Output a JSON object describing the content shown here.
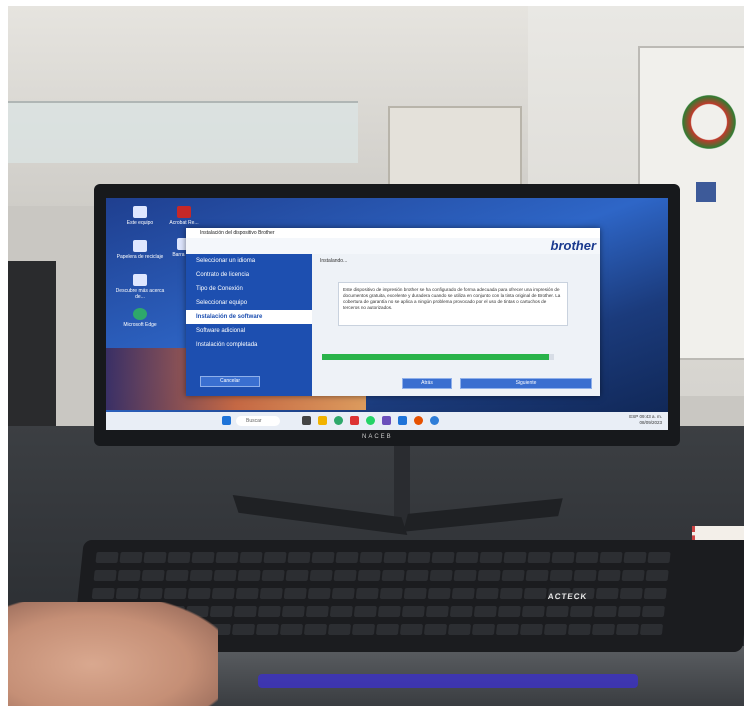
{
  "desktop_icons": [
    {
      "label": "Este equipo"
    },
    {
      "label": "Acrobat Re..."
    },
    {
      "label": "Papelera de reciclaje"
    },
    {
      "label": "Barra de..."
    },
    {
      "label": "Descubre más acerca de..."
    },
    {
      "label": "Microsoft Edge"
    }
  ],
  "wallpaper_brand": "brother",
  "installer": {
    "window_title": "Instalación del dispositivo Brother",
    "brand": "brother",
    "steps": [
      {
        "label": "Seleccionar un idioma",
        "active": false
      },
      {
        "label": "Contrato de licencia",
        "active": false
      },
      {
        "label": "Tipo de Conexión",
        "active": false
      },
      {
        "label": "Seleccionar equipo",
        "active": false
      },
      {
        "label": "Instalación de software",
        "active": true
      },
      {
        "label": "Software adicional",
        "active": false
      },
      {
        "label": "Instalación completada",
        "active": false
      }
    ],
    "status_text": "Instalando...",
    "message": "Este dispositivo de impresión brother se ha configurado de forma adecuada para ofrecer una impresión de documentos gratuita, excelente y duradera cuando se utiliza en conjunto con la tinta original de Brother. La cobertura de garantía no se aplica a ningún problema provocado por el uso de tintas o cartuchos de terceros no autorizados.",
    "progress": 0.98,
    "buttons": {
      "cancel": "Cancelar",
      "back": "Atrás",
      "next": "Siguiente"
    }
  },
  "taskbar": {
    "search_placeholder": "Buscar",
    "tray_lang": "ESP",
    "tray_time": "09:43 a. m.",
    "tray_date": "08/09/2023"
  },
  "monitor_brand": "NACEB",
  "keyboard_brand": "ACTECK",
  "colors": {
    "installer_sidebar": "#1d4fb0",
    "progress": "#29b34a",
    "brother_blue": "#1a3a8f"
  }
}
